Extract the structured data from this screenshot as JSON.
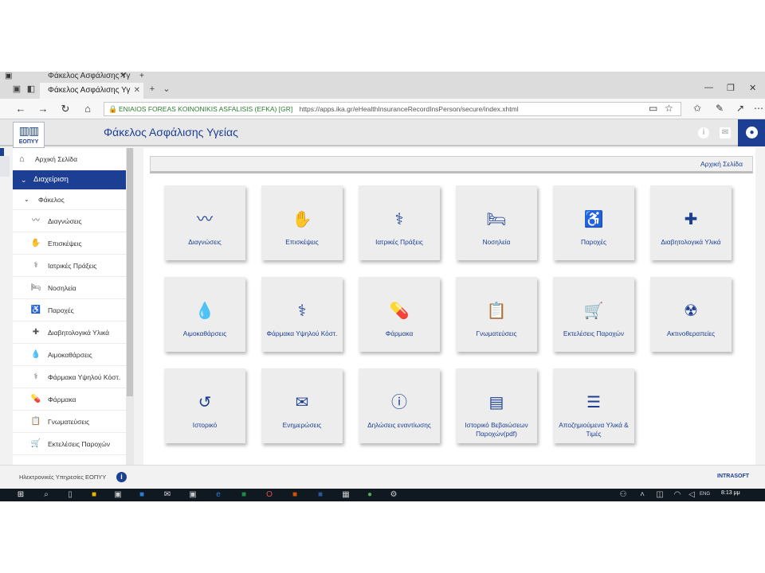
{
  "browser": {
    "back_tab_title": "Φάκελος Ασφάλισης Υγ",
    "tab_title": "Φάκελος Ασφάλισης Υγ",
    "site_name": "ENIAIOS FOREAS KOINONIKIS ASFALISIS (EFKA) [GR]",
    "url": "https://apps.ika.gr/eHealthInsuranceRecordInsPerson/secure/index.xhtml"
  },
  "header": {
    "logo_text": "ΕΟΠΥΥ",
    "title": "Φάκελος Ασφάλισης Υγείας"
  },
  "sidebar": {
    "home": "Αρχική Σελίδα",
    "admin": "Διαχείριση",
    "folder": "Φάκελος",
    "items": [
      {
        "label": "Διαγνώσεις",
        "icon": "pulse-icon"
      },
      {
        "label": "Επισκέψεις",
        "icon": "hand-care-icon"
      },
      {
        "label": "Ιατρικές Πράξεις",
        "icon": "doctor-icon"
      },
      {
        "label": "Νοσηλεία",
        "icon": "bed-icon"
      },
      {
        "label": "Παροχές",
        "icon": "wheelchair-icon"
      },
      {
        "label": "Διαβητολογικά Υλικά",
        "icon": "glucose-meter-icon"
      },
      {
        "label": "Αιμοκαθάρσεις",
        "icon": "blood-drop-icon"
      },
      {
        "label": "Φάρμακα Υψηλού Κόστ.",
        "icon": "medical-symbol-icon"
      },
      {
        "label": "Φάρμακα",
        "icon": "pill-icon"
      },
      {
        "label": "Γνωματεύσεις",
        "icon": "notes-icon"
      },
      {
        "label": "Εκτελέσεις Παροχών",
        "icon": "medical-cart-icon"
      }
    ]
  },
  "main": {
    "breadcrumb": "Αρχική Σελίδα",
    "cards": [
      {
        "label": "Διαγνώσεις",
        "icon": "pulse-icon"
      },
      {
        "label": "Επισκέψεις",
        "icon": "hand-care-icon"
      },
      {
        "label": "Ιατρικές Πράξεις",
        "icon": "doctor-icon"
      },
      {
        "label": "Νοσηλεία",
        "icon": "bed-icon"
      },
      {
        "label": "Παροχές",
        "icon": "wheelchair-icon"
      },
      {
        "label": "Διαβητολογικά Υλικά",
        "icon": "glucose-meter-icon"
      },
      {
        "label": "Αιμοκαθάρσεις",
        "icon": "blood-drop-icon"
      },
      {
        "label": "Φάρμακα Υψηλού Κόστ.",
        "icon": "medical-symbol-icon"
      },
      {
        "label": "Φάρμακα",
        "icon": "pill-icon"
      },
      {
        "label": "Γνωματεύσεις",
        "icon": "notes-icon"
      },
      {
        "label": "Εκτελέσεις Παροχών",
        "icon": "medical-cart-icon"
      },
      {
        "label": "Ακτινοθεραπείες",
        "icon": "radiation-icon"
      },
      {
        "label": "Ιστορικό",
        "icon": "history-icon"
      },
      {
        "label": "Ενημερώσεις",
        "icon": "envelope-icon"
      },
      {
        "label": "Δηλώσεις εναντίωσης",
        "icon": "info-icon"
      },
      {
        "label": "Ιστορικό Βεβαιώσεων Παροχών(pdf)",
        "icon": "document-icon"
      },
      {
        "label": "Αποζημιούμενα Υλικά & Τιμές",
        "icon": "list-icon"
      }
    ]
  },
  "footer": {
    "text": "Ηλεκτρονικές Υπηρεσίες ΕΟΠΥΥ",
    "brand": "INTRASOFT"
  },
  "taskbar": {
    "clock": "8:13 μμ",
    "lang": "ENG"
  },
  "colors": {
    "primary": "#1c3f94",
    "card_bg": "#ededed",
    "site_green": "#2e7d32"
  }
}
